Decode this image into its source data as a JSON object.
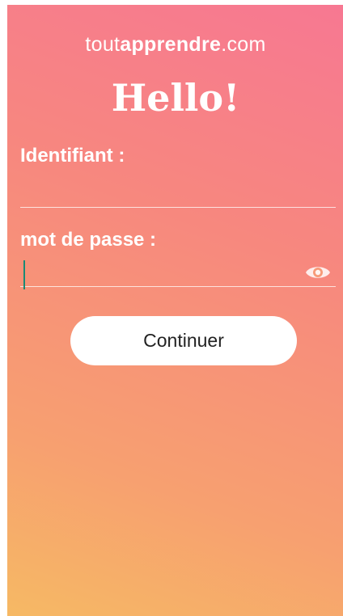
{
  "brand": {
    "prefix": "tout",
    "bold": "apprendre",
    "suffix": ".com"
  },
  "greeting": "Hello!",
  "login_form": {
    "username_label": "Identifiant :",
    "username_value": "",
    "password_label": "mot de passe :",
    "password_value": "",
    "password_visibility_icon": "eye-icon",
    "submit_label": "Continuer"
  },
  "colors": {
    "gradient_top_right": "#f77892",
    "gradient_bottom_left": "#f6b964",
    "text": "#ffffff",
    "button_bg": "#ffffff",
    "button_text": "#222222",
    "caret": "#1b8a75"
  }
}
